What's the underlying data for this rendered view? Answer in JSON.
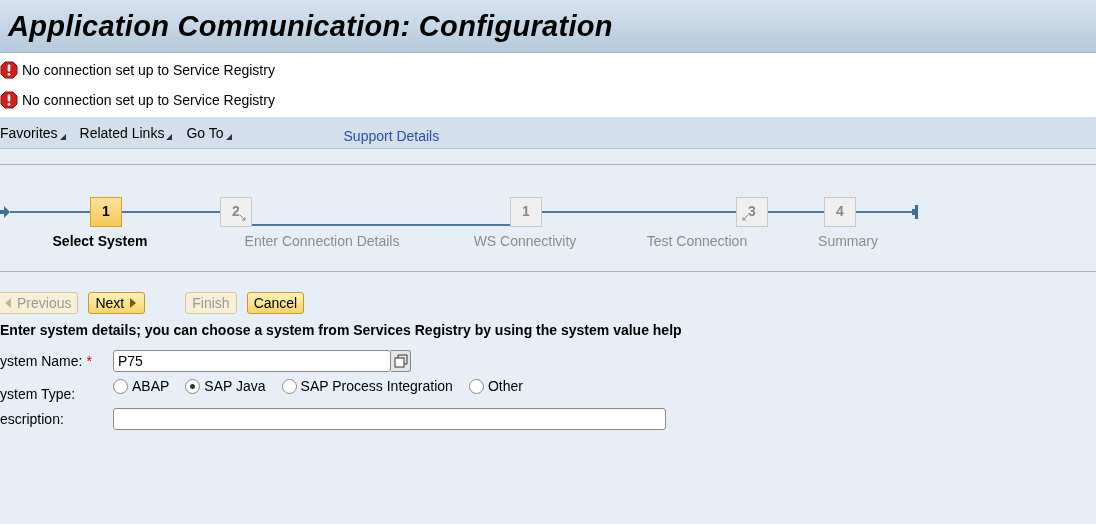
{
  "window": {
    "title": "Application Communication: Configuration"
  },
  "messages": [
    {
      "kind": "error",
      "text": "No connection set up to Service Registry"
    },
    {
      "kind": "error",
      "text": "No connection set up to Service Registry"
    }
  ],
  "toolbar": {
    "menus": [
      "Favorites",
      "Related Links",
      "Go To"
    ],
    "link": "Support Details"
  },
  "steps": [
    {
      "number": "1",
      "label": "Select System",
      "selected": true,
      "kind": "plain"
    },
    {
      "number": "2",
      "label": "Enter Connection Details",
      "selected": false,
      "kind": "branch-out"
    },
    {
      "number": "1",
      "label": "WS Connectivity",
      "selected": false,
      "kind": "plain"
    },
    {
      "number": "3",
      "label": "Test Connection",
      "selected": false,
      "kind": "branch-in"
    },
    {
      "number": "4",
      "label": "Summary",
      "selected": false,
      "kind": "plain"
    }
  ],
  "buttons": [
    {
      "label": "Previous",
      "kind": "previous",
      "disabled": true
    },
    {
      "label": "Next",
      "kind": "next",
      "disabled": false
    },
    {
      "label": "Finish",
      "kind": "finish",
      "disabled": true
    },
    {
      "label": "Cancel",
      "kind": "cancel",
      "disabled": false
    }
  ],
  "instruction": "Enter system details; you can choose a system from Services Registry by using the system value help",
  "form": {
    "system_name": {
      "label": "ystem Name:",
      "required_mark": "*",
      "value": "P75"
    },
    "system_type": {
      "label": "ystem Type:",
      "options": [
        {
          "label": "ABAP",
          "selected": false
        },
        {
          "label": "SAP Java",
          "selected": true
        },
        {
          "label": "SAP Process Integration",
          "selected": false
        },
        {
          "label": "Other",
          "selected": false
        }
      ]
    },
    "description": {
      "label": "escription:"
    }
  }
}
